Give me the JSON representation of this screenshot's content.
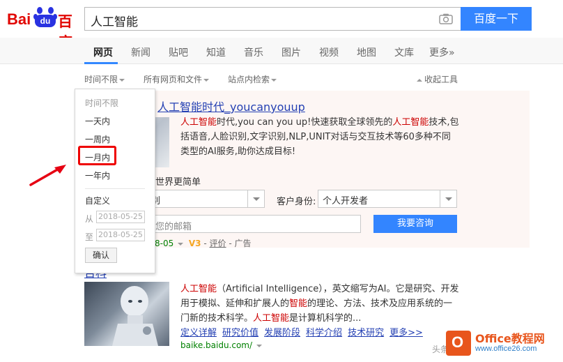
{
  "header": {
    "logo_latin": "Bai",
    "logo_du": "du",
    "logo_cn": "百度",
    "query": "人工智能",
    "search_button": "百度一下",
    "brand_color": "#e10602",
    "accent_color": "#3385ff"
  },
  "tabs": [
    {
      "label": "网页",
      "active": true
    },
    {
      "label": "新闻"
    },
    {
      "label": "贴吧"
    },
    {
      "label": "知道"
    },
    {
      "label": "音乐"
    },
    {
      "label": "图片"
    },
    {
      "label": "视频"
    },
    {
      "label": "地图"
    },
    {
      "label": "文库"
    },
    {
      "label": "更多»"
    }
  ],
  "filters": {
    "time": "时间不限",
    "filetype": "所有网页和文件",
    "site": "站点内检索",
    "collapse": "收起工具"
  },
  "time_dropdown": {
    "items": [
      "时间不限",
      "一天内",
      "一周内",
      "一月内",
      "一年内"
    ],
    "highlighted": "一月内",
    "custom_label": "自定义",
    "from_label": "从",
    "to_label": "至",
    "from_date": "2018-05-25",
    "to_date": "2018-05-25",
    "confirm": "确认"
  },
  "ad": {
    "title": "人工智能时代_youcanyouup",
    "desc_parts": [
      {
        "text": "人工智能",
        "red": true
      },
      {
        "text": "时代,you can you up!快速获取全球领先的"
      },
      {
        "text": "人工智能",
        "red": true
      },
      {
        "text": "技术,包括语音,人脸识别,文字识别,NLP,UNIT对话与交互技术等60多种不同类型的AI服务,助你达成目标!"
      }
    ],
    "sub_heading": "世界更简单",
    "select1_value": "别",
    "role_label": "客户身份:",
    "role_value": "个人开发者",
    "email_placeholder": "您的邮箱",
    "consult_button": "我要咨询",
    "meta_date": "8-05",
    "meta_v": "V3",
    "meta_review": "评价",
    "meta_tail": " - 广告"
  },
  "result": {
    "title": "百科",
    "desc_parts": [
      {
        "text": "人工智能",
        "red": true
      },
      {
        "text": "（Artificial Intelligence），英文缩写为AI。它是研究、开发用于模拟、延伸和扩展人的"
      },
      {
        "text": "智能",
        "red": true
      },
      {
        "text": "的理论、方法、技术及应用系统的一门新的技术科学。"
      },
      {
        "text": "人工智能",
        "red": true
      },
      {
        "text": "是计算机科学的..."
      }
    ],
    "links": [
      "定义详解",
      "研究价值",
      "发展阶段",
      "科学介绍",
      "技术研究",
      "更多>>"
    ],
    "url": "baike.baidu.com/"
  },
  "watermark": {
    "brand": "Office教程网",
    "site": "www.office26.com",
    "caption": "头条"
  }
}
